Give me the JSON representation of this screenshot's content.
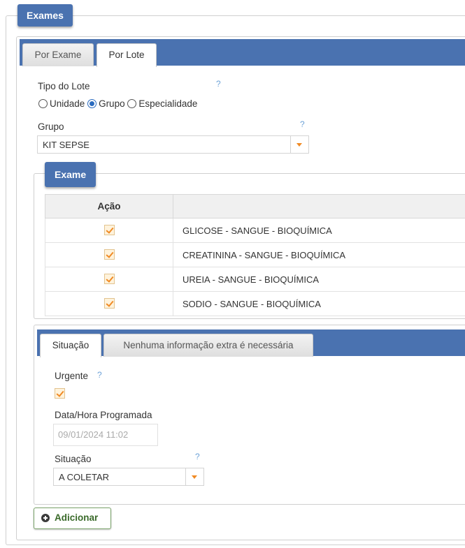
{
  "exames_legend": "Exames",
  "tabs": [
    {
      "label": "Por Exame",
      "active": false
    },
    {
      "label": "Por Lote",
      "active": true
    }
  ],
  "tipo_lote": {
    "label": "Tipo do Lote",
    "help": "?",
    "options": [
      {
        "label": "Unidade",
        "selected": false
      },
      {
        "label": "Grupo",
        "selected": true
      },
      {
        "label": "Especialidade",
        "selected": false
      }
    ]
  },
  "grupo": {
    "label": "Grupo",
    "help": "?",
    "value": "KIT SEPSE"
  },
  "exame_legend": "Exame",
  "table": {
    "headers": [
      "Ação",
      ""
    ],
    "rows": [
      {
        "checked": true,
        "name": "GLICOSE - SANGUE - BIOQUÍMICA"
      },
      {
        "checked": true,
        "name": "CREATININA - SANGUE - BIOQUÍMICA"
      },
      {
        "checked": true,
        "name": "UREIA - SANGUE - BIOQUÍMICA"
      },
      {
        "checked": true,
        "name": "SODIO - SANGUE - BIOQUÍMICA"
      }
    ]
  },
  "sub_tabs": [
    {
      "label": "Situação",
      "active": true
    },
    {
      "label": "Nenhuma informação extra é necessária",
      "active": false
    }
  ],
  "urgente": {
    "label": "Urgente",
    "help": "?",
    "checked": true
  },
  "data_hora": {
    "label": "Data/Hora Programada",
    "value": "09/01/2024 11:02"
  },
  "situacao": {
    "label": "Situação",
    "help": "?",
    "value": "A COLETAR"
  },
  "add_button": "Adicionar",
  "colors": {
    "accent": "#4a72b0",
    "check": "#f08a24",
    "help": "#6fa3d8"
  }
}
